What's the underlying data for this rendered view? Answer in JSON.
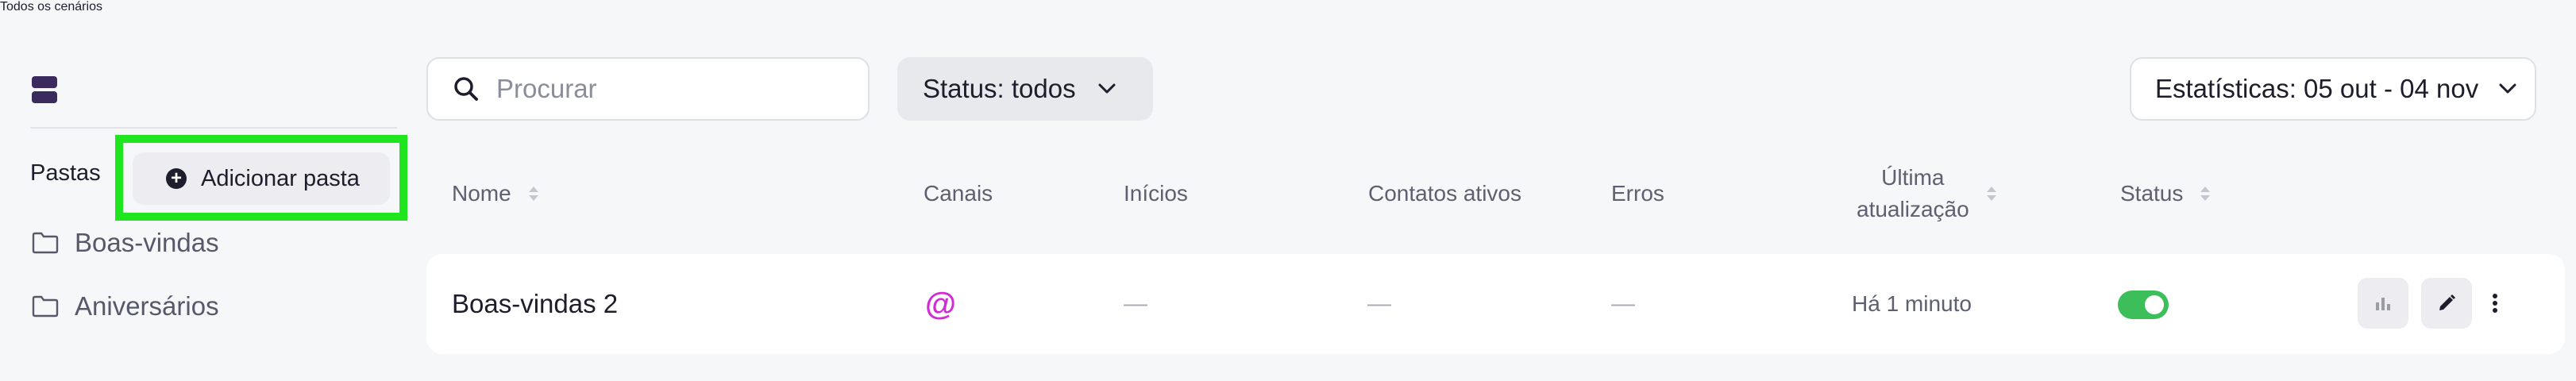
{
  "sidebar": {
    "all_scenarios": "Todos os cenários",
    "folders_label": "Pastas",
    "add_folder": "Adicionar pasta",
    "add_folder_icon": "plus-circle-icon",
    "folders": [
      {
        "label": "Boas-vindas",
        "icon": "folder-icon"
      },
      {
        "label": "Aniversários",
        "icon": "folder-icon"
      }
    ]
  },
  "toolbar": {
    "search_placeholder": "Procurar",
    "search_value": "",
    "status_filter": "Status: todos",
    "stats_filter": "Estatísticas: 05 out - 04 nov"
  },
  "table": {
    "columns": {
      "name": "Nome",
      "channels": "Canais",
      "starts": "Inícios",
      "active_contacts": "Contatos ativos",
      "errors": "Erros",
      "last_update_line1": "Última",
      "last_update_line2": "atualização",
      "status": "Status"
    },
    "rows": [
      {
        "name": "Boas-vindas 2",
        "channel": "@",
        "starts": "—",
        "active_contacts": "—",
        "errors": "—",
        "last_update": "Há 1 minuto",
        "status_enabled": true
      }
    ]
  },
  "colors": {
    "accent": "#3b2a5e",
    "highlight_border": "#1ee51e",
    "toggle_on": "#3cbf5a",
    "channel": "#d12bd4"
  }
}
